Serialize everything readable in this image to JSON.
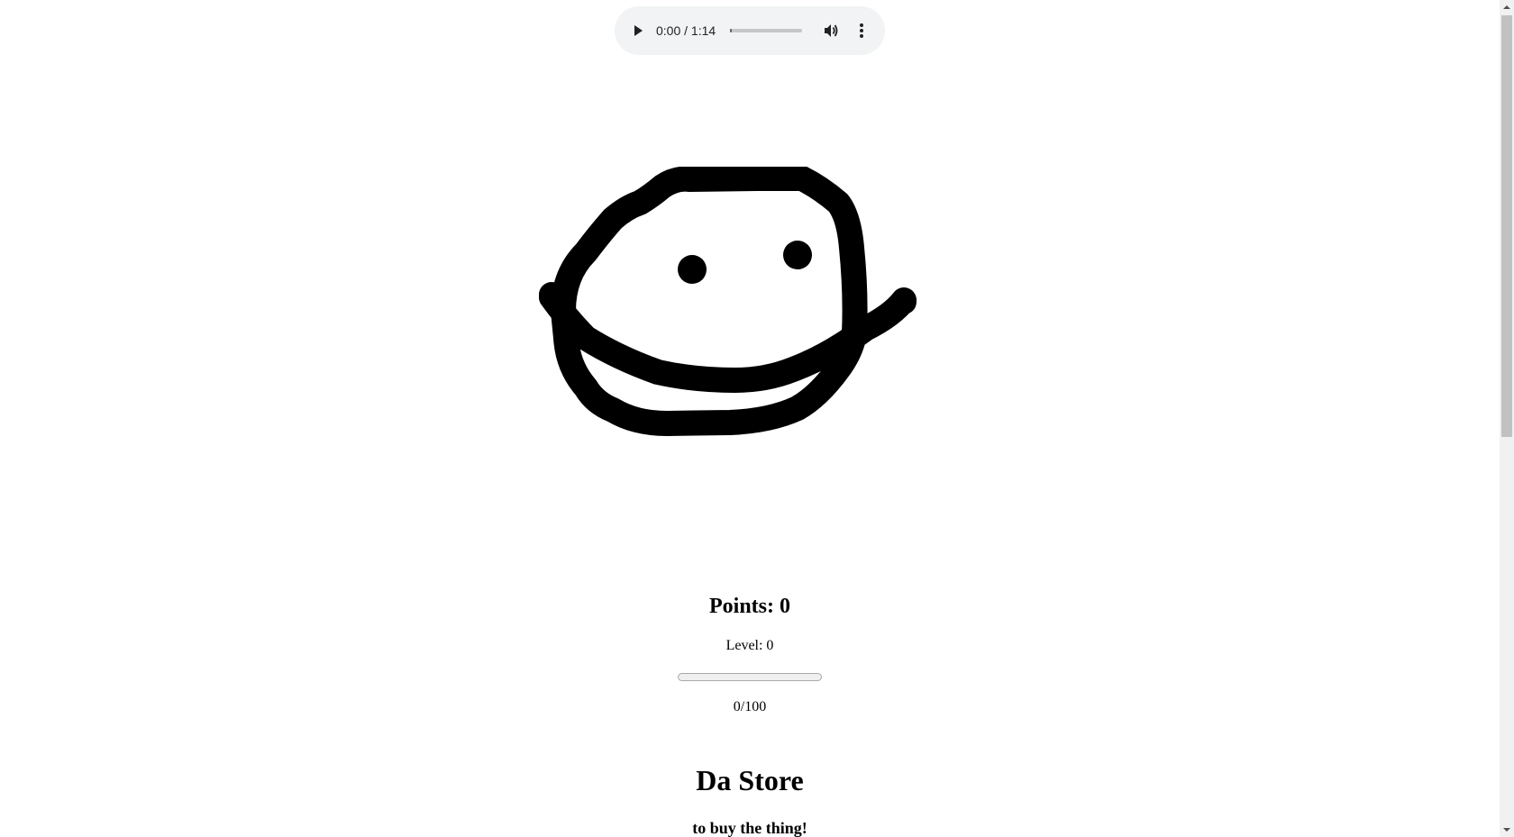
{
  "audio": {
    "time_display": "0:00 / 1:14",
    "progress": 0,
    "icons": [
      "play-icon",
      "volume-icon",
      "more-options-icon"
    ]
  },
  "clicker": {
    "icon": "smiley-blob-drawing"
  },
  "stats": {
    "points_label": "Points: 0",
    "level_label": "Level: 0",
    "progress_value": 0,
    "progress_max": 100,
    "progress_text": "0/100"
  },
  "store": {
    "title": "Da Store",
    "subtitle": "to buy the thing!"
  },
  "colors": {
    "player_bg": "#f1f3f4",
    "ink": "#000000",
    "scrollbar_track": "#f1f1f1",
    "scrollbar_thumb": "#c1c1c1"
  }
}
